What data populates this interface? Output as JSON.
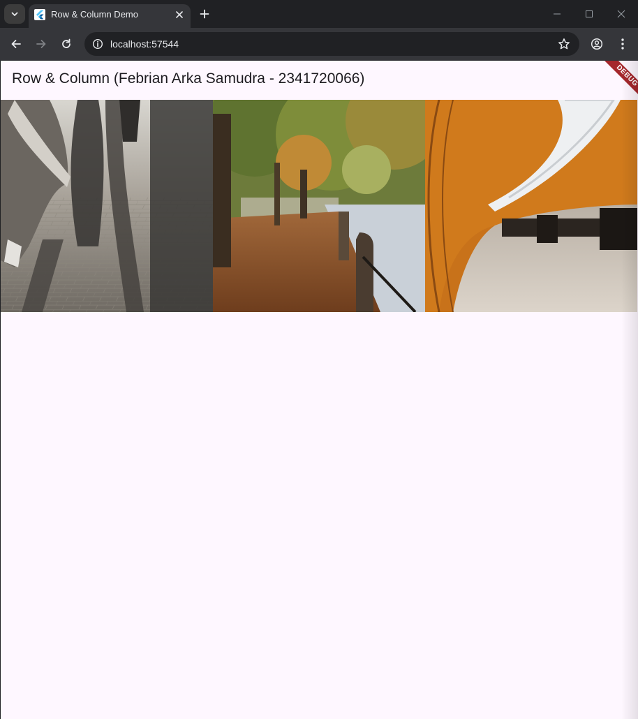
{
  "browser": {
    "tab": {
      "title": "Row & Column Demo",
      "favicon": "flutter-icon"
    },
    "address_bar": {
      "url": "localhost:57544"
    },
    "icons": {
      "tab_search": "chevron-down-icon",
      "tab_close": "close-icon",
      "new_tab": "plus-icon",
      "minimize": "minimize-icon",
      "maximize": "maximize-icon",
      "close_window": "close-icon",
      "back": "arrow-left-icon",
      "forward": "arrow-right-icon",
      "reload": "reload-icon",
      "site_info": "info-icon",
      "bookmark": "star-icon",
      "profile": "profile-icon",
      "menu": "kebab-menu-icon"
    }
  },
  "app": {
    "title": "Row & Column (Febrian Arka Samudra - 2341720066)",
    "debug_banner": "DEBUG",
    "photos": [
      {
        "subject": "shadows-on-brick-sidewalk"
      },
      {
        "subject": "autumn-leaves-riverside-path"
      },
      {
        "subject": "orange-curved-subway-station"
      }
    ]
  },
  "colors": {
    "chrome_dark": "#202124",
    "chrome_toolbar": "#35363a",
    "page_background": "#fef7ff",
    "debug_ribbon": "#a5282d",
    "text_primary": "#1d1b20"
  }
}
